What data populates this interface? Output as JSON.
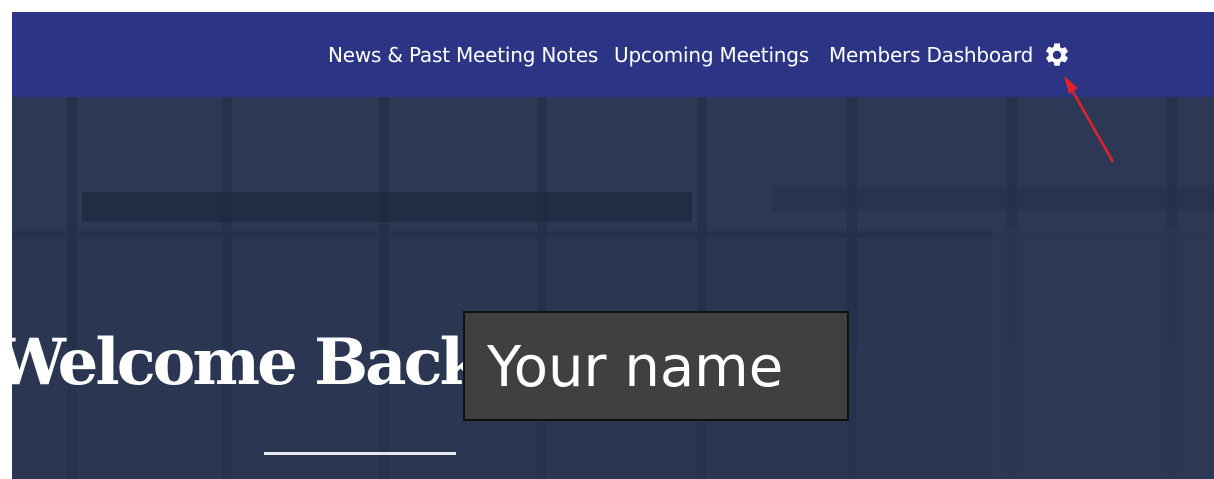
{
  "nav": {
    "items": [
      {
        "label": "News & Past Meeting Notes"
      },
      {
        "label": "Upcoming Meetings"
      },
      {
        "label": "Members Dashboard"
      }
    ],
    "settings_icon": "gear-icon"
  },
  "hero": {
    "welcome_text": "Welcome Back",
    "name_placeholder_text": "Your name"
  },
  "colors": {
    "navbar": "#2c3585",
    "hero_overlay": "#2b3653",
    "annotation_arrow": "#e0232a"
  }
}
